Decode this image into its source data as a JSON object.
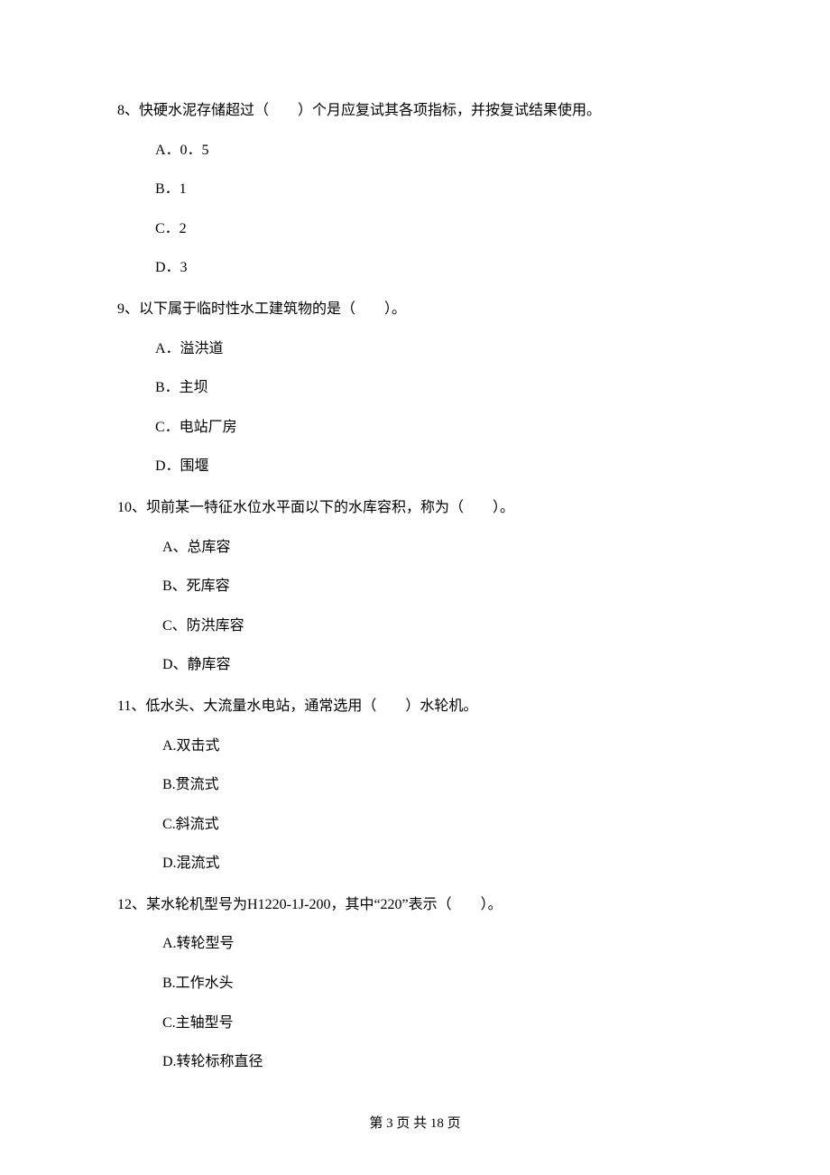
{
  "questions": [
    {
      "number": "8、",
      "text": "快硬水泥存储超过（　　）个月应复试其各项指标，并按复试结果使用。",
      "options": [
        {
          "label": "A．0．5"
        },
        {
          "label": "B．1"
        },
        {
          "label": "C．2"
        },
        {
          "label": "D．3"
        }
      ]
    },
    {
      "number": "9、",
      "text": "以下属于临时性水工建筑物的是（　　）。",
      "options": [
        {
          "label": "A．溢洪道"
        },
        {
          "label": "B．主坝"
        },
        {
          "label": "C．电站厂房"
        },
        {
          "label": "D．围堰"
        }
      ]
    },
    {
      "number": "10、",
      "text": "坝前某一特征水位水平面以下的水库容积，称为（　　）。",
      "options": [
        {
          "label": "A、总库容"
        },
        {
          "label": "B、死库容"
        },
        {
          "label": "C、防洪库容"
        },
        {
          "label": "D、静库容"
        }
      ]
    },
    {
      "number": "11、",
      "text": "低水头、大流量水电站，通常选用（　　）水轮机。",
      "options": [
        {
          "label": "A.双击式"
        },
        {
          "label": "B.贯流式"
        },
        {
          "label": "C.斜流式"
        },
        {
          "label": "D.混流式"
        }
      ]
    },
    {
      "number": "12、",
      "text": "某水轮机型号为H1220-1J-200，其中“220”表示（　　）。",
      "options": [
        {
          "label": "A.转轮型号"
        },
        {
          "label": "B.工作水头"
        },
        {
          "label": "C.主轴型号"
        },
        {
          "label": "D.转轮标称直径"
        }
      ]
    }
  ],
  "footer": "第 3 页 共 18 页"
}
